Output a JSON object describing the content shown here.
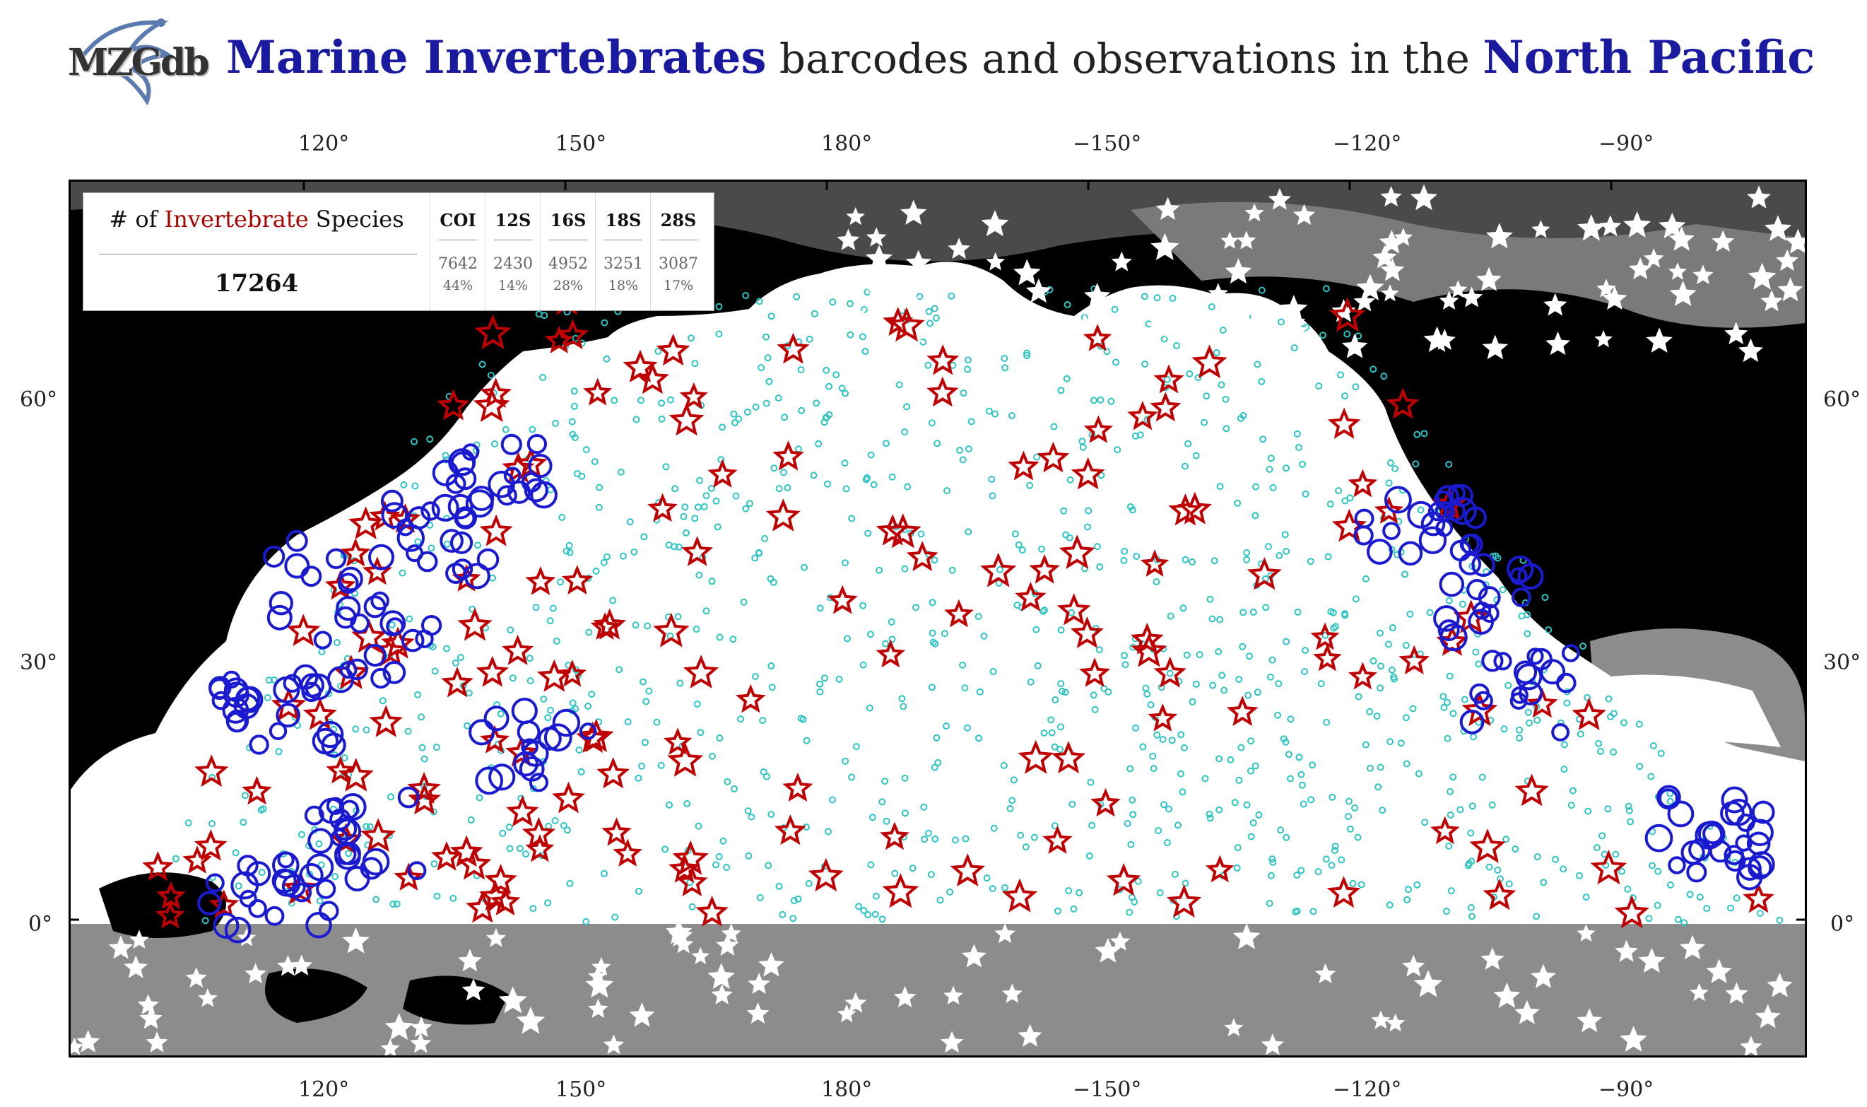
{
  "header": {
    "logo_text": "MZGdb",
    "title_part1": "Marine Invertebrates",
    "title_part2": " barcodes and observations in the ",
    "title_part3": "North Pacific"
  },
  "axes": {
    "top_lon": [
      "120°",
      "150°",
      "180°",
      "−150°",
      "−120°",
      "−90°"
    ],
    "bottom_lon": [
      "120°",
      "150°",
      "180°",
      "−150°",
      "−120°",
      "−90°"
    ],
    "left_lat": [
      "60°",
      "30°",
      "0°"
    ],
    "right_lat": [
      "60°",
      "30°",
      "0°"
    ]
  },
  "stats": {
    "heading_prefix": "# of ",
    "heading_highlight": "Invertebrate",
    "heading_suffix": " Species",
    "total": "17264",
    "markers": [
      {
        "label": "COI",
        "count": "7642",
        "percent": "44%"
      },
      {
        "label": "12S",
        "count": "2430",
        "percent": "14%"
      },
      {
        "label": "16S",
        "count": "4952",
        "percent": "28%"
      },
      {
        "label": "18S",
        "count": "3251",
        "percent": "18%"
      },
      {
        "label": "28S",
        "count": "3087",
        "percent": "17%"
      }
    ]
  },
  "colors": {
    "ocean_region": "#ffffff",
    "land": "#000000",
    "outside_ocean": "#8c8c8c",
    "barcode_star": "#c00000",
    "barcode_circle": "#1a1ad0",
    "observation_dot": "#2ec4c4",
    "white_star": "#ffffff",
    "title_blue": "#1a1aa0",
    "heading_red": "#a00000"
  }
}
